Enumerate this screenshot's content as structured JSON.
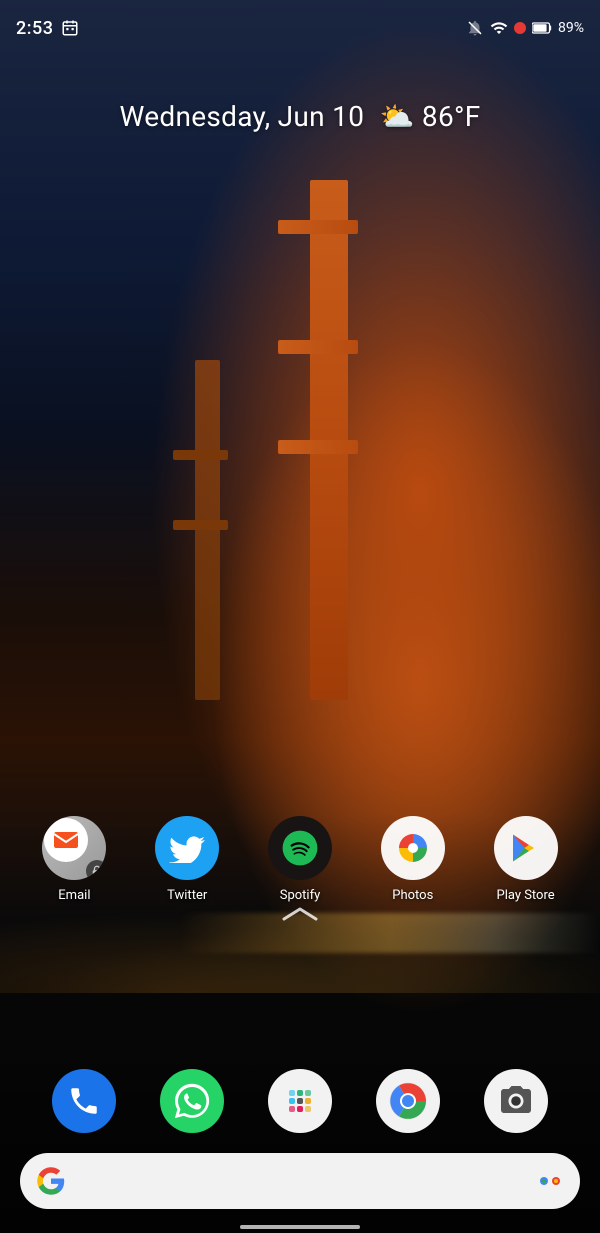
{
  "statusBar": {
    "time": "2:53",
    "battery": "89%",
    "calendarIcon": "📅"
  },
  "dateWeather": {
    "date": "Wednesday, Jun 10",
    "temperature": "86°F",
    "weatherIcon": "⛅"
  },
  "apps": {
    "row1": [
      {
        "id": "email",
        "label": "Email",
        "bgColor": "#aaa"
      },
      {
        "id": "twitter",
        "label": "Twitter",
        "bgColor": "#1da1f2"
      },
      {
        "id": "spotify",
        "label": "Spotify",
        "bgColor": "#191414"
      },
      {
        "id": "photos",
        "label": "Photos",
        "bgColor": "#fff"
      },
      {
        "id": "playstore",
        "label": "Play Store",
        "bgColor": "#fff"
      }
    ],
    "dock": [
      {
        "id": "phone",
        "label": ""
      },
      {
        "id": "whatsapp",
        "label": ""
      },
      {
        "id": "slack",
        "label": ""
      },
      {
        "id": "chrome",
        "label": ""
      },
      {
        "id": "camera",
        "label": ""
      }
    ]
  },
  "searchBar": {
    "placeholder": ""
  }
}
